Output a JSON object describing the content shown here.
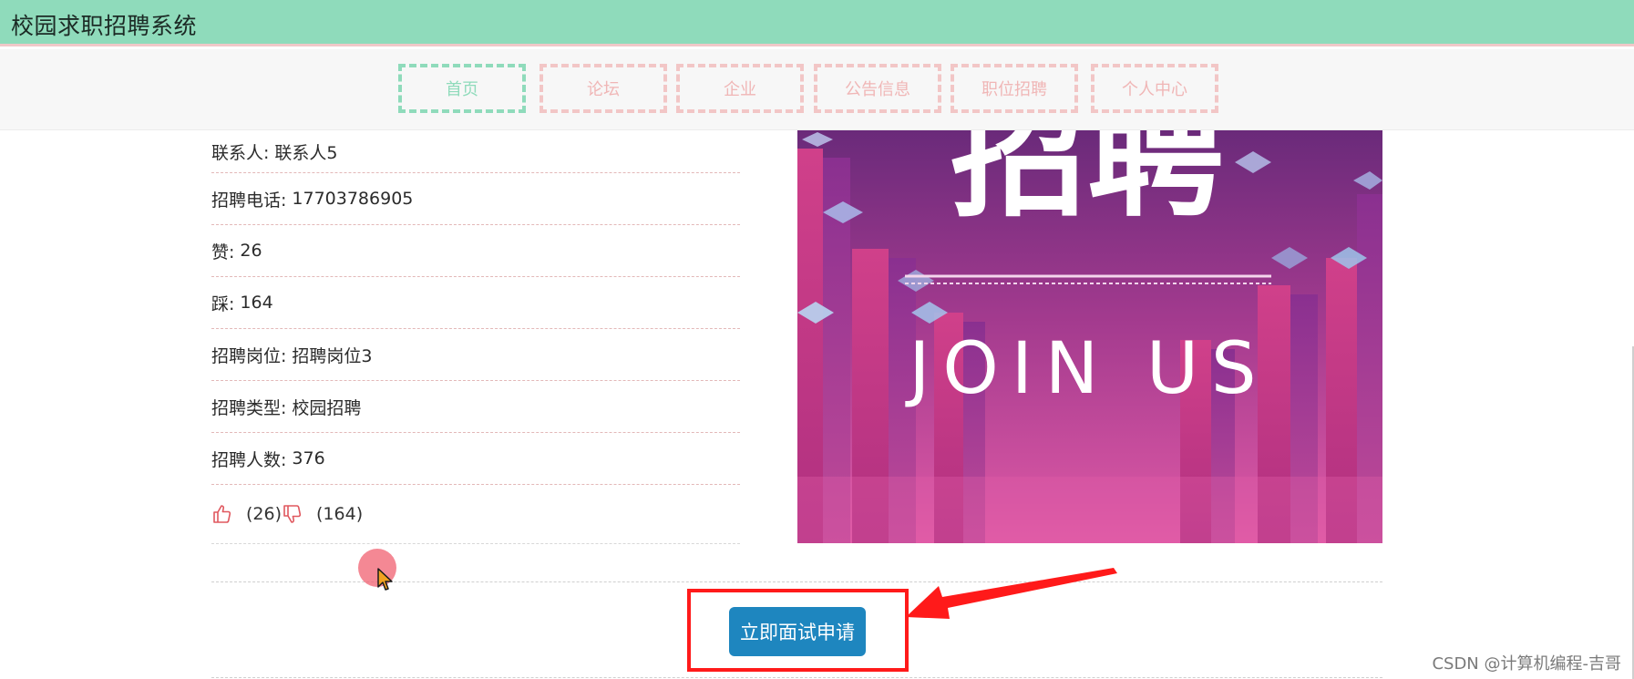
{
  "header": {
    "app_title": "校园求职招聘系统"
  },
  "nav": {
    "items": [
      {
        "label": "首页",
        "active": true
      },
      {
        "label": "论坛",
        "active": false
      },
      {
        "label": "企业",
        "active": false
      },
      {
        "label": "公告信息",
        "active": false
      },
      {
        "label": "职位招聘",
        "active": false
      },
      {
        "label": "个人中心",
        "active": false
      }
    ]
  },
  "detail": {
    "rows": [
      {
        "label": "联系人:",
        "value": "联系人5"
      },
      {
        "label": "招聘电话:",
        "value": "17703786905"
      },
      {
        "label": "赞:",
        "value": "26"
      },
      {
        "label": "踩:",
        "value": "164"
      },
      {
        "label": "招聘岗位:",
        "value": "招聘岗位3"
      },
      {
        "label": "招聘类型:",
        "value": "校园招聘"
      },
      {
        "label": "招聘人数:",
        "value": "376"
      }
    ],
    "votes": {
      "like_count": "(26)",
      "dislike_count": "(164)"
    }
  },
  "poster": {
    "title_text": "招聘",
    "subtitle_text": "JOIN US"
  },
  "actions": {
    "apply_label": "立即面试申请"
  },
  "watermark": "CSDN @计算机编程-吉哥",
  "colors": {
    "header_bg": "#8fdbbb",
    "nav_active": "#8fdbbb",
    "nav_inactive": "#f2c6c6",
    "button_bg": "#1e86bf",
    "highlight": "#ff1a1a"
  },
  "icons": [
    "thumbs-up-icon",
    "thumbs-down-icon",
    "arrow-annotation-icon",
    "mouse-pointer-icon"
  ]
}
